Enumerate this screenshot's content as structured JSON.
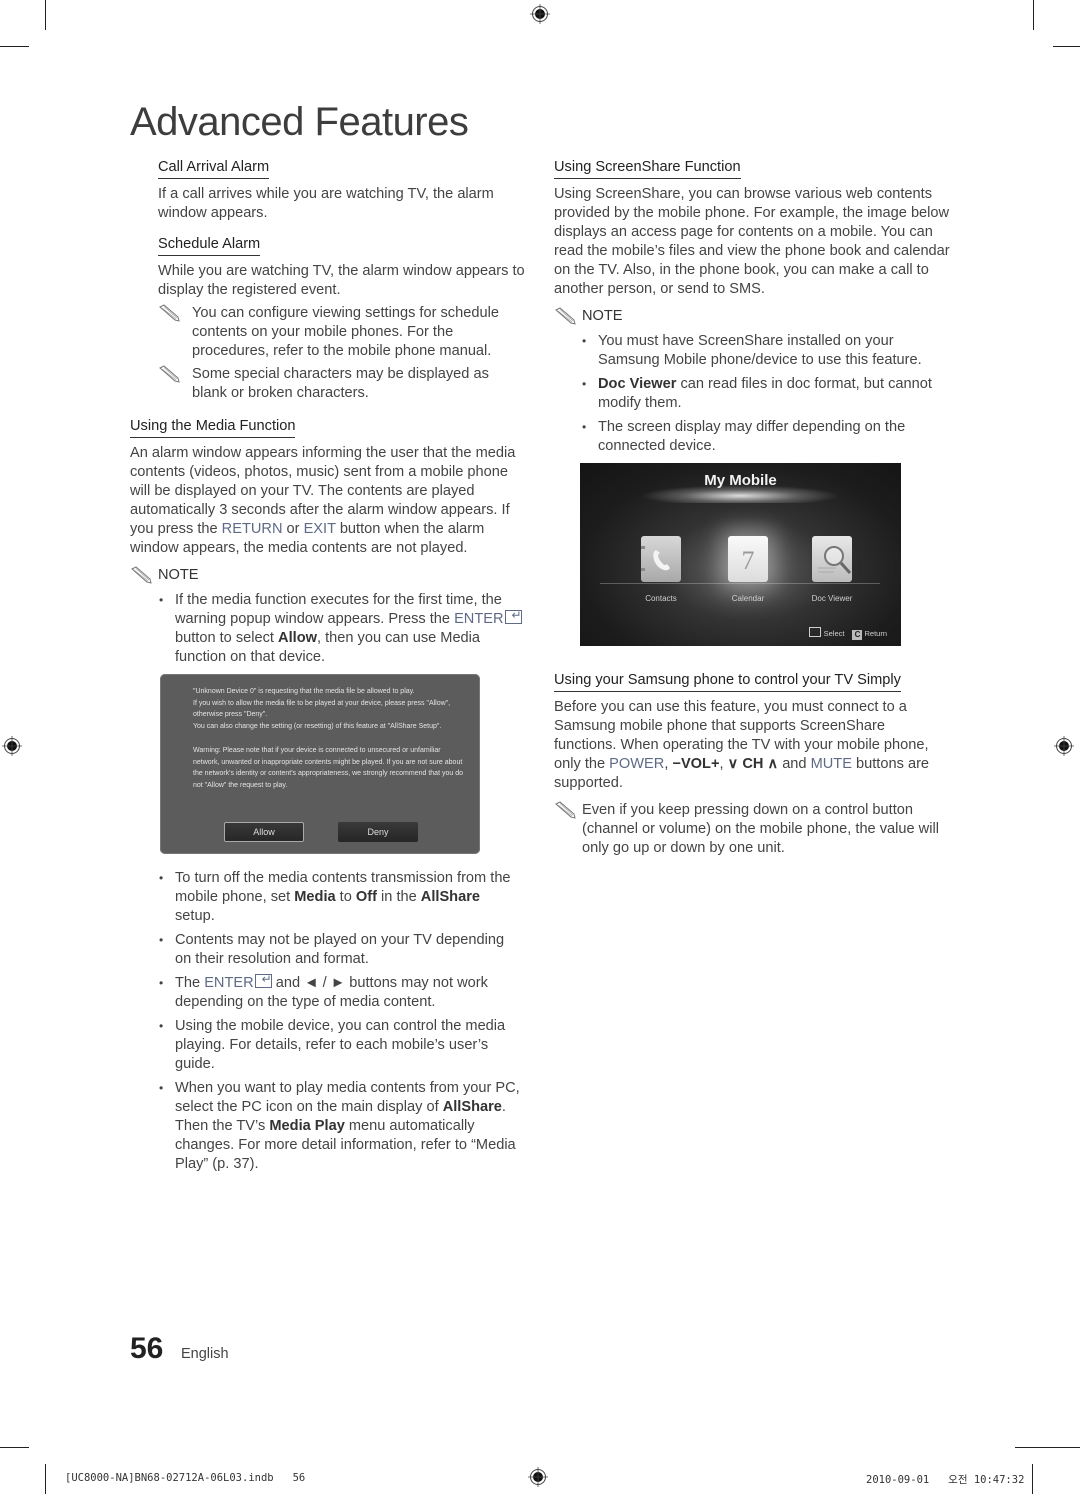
{
  "page": {
    "title": "Advanced Features",
    "page_number": "56",
    "language": "English"
  },
  "left_column": {
    "call_arrival": {
      "heading": "Call Arrival Alarm",
      "body": "If a call arrives while you are watching TV, the alarm window appears."
    },
    "schedule_alarm": {
      "heading": "Schedule Alarm",
      "body": "While you are watching TV, the alarm window appears to display the registered event.",
      "notes": [
        "You can configure viewing settings for schedule contents on your mobile phones. For the procedures, refer to the mobile phone manual.",
        "Some special characters may be displayed as blank or broken characters."
      ]
    },
    "media_function": {
      "heading": "Using the Media Function",
      "body_1": "An alarm window appears informing the user that the media contents (videos, photos, music) sent from a mobile phone will be displayed on your TV. The contents are played automatically 3 seconds after the alarm window appears. If you press the ",
      "return_label": "RETURN",
      "or_text": " or ",
      "exit_label": "EXIT",
      "body_2": " button when the alarm window appears, the media contents are not played.",
      "note_label": "NOTE",
      "note_1": {
        "pre": "If the media function executes for the first time, the warning popup window appears. Press the ",
        "enter": "ENTER",
        "mid": " button to select ",
        "allow": "Allow",
        "post": ", then you can use Media function on that device."
      },
      "bullets_after_popup": {
        "b1": {
          "pre": "To turn off the media contents transmission from the mobile phone, set ",
          "media": "Media",
          "to": " to ",
          "off": "Off",
          "in_the": " in the ",
          "allshare": "AllShare",
          "post": " setup."
        },
        "b2": "Contents may not be played on your TV depending on their resolution and format.",
        "b3": {
          "pre": "The ",
          "enter": "ENTER",
          "post": " and ◄ / ► buttons may not work depending on the type of media content."
        },
        "b4": "Using the mobile device, you can control the media playing. For details, refer to each mobile’s user’s guide.",
        "b5": {
          "pre": "When you want to play media contents from your PC, select the PC icon on the main display of ",
          "allshare": "AllShare",
          "mid": ". Then the TV’s ",
          "media_play": "Media Play",
          "post": " menu automatically changes. For more detail information, refer to “Media Play” (p. 37)."
        }
      }
    },
    "popup": {
      "line1": "\"Unknown Device 0\" is requesting that the media file be allowed to play.",
      "line2": "If you wish to allow the media file to be played at your device, please press \"Allow\", otherwise press \"Deny\".",
      "line3": "You can also change the setting (or resetting) of this feature at \"AllShare Setup\".",
      "warning": "Warning: Please note that if your device is connected to unsecured or unfamiliar network, unwanted or inappropriate contents might be played. If you are not sure about the network's identity or content's appropriateness, we strongly recommend that you do not \"Allow\" the request to play.",
      "allow_button": "Allow",
      "deny_button": "Deny"
    }
  },
  "right_column": {
    "screenshare": {
      "heading": "Using ScreenShare Function",
      "body": "Using ScreenShare, you can browse various web contents provided by the mobile phone. For example, the image below displays an access page for contents on a mobile. You can read the mobile’s files and view the phone book and calendar on the TV. Also, in the phone book, you can make a call to another person, or send to SMS.",
      "note_label": "NOTE",
      "notes": {
        "n1": "You must have ScreenShare installed on your Samsung Mobile phone/device to use this feature.",
        "n2_bold": "Doc Viewer",
        "n2_rest": " can read files in doc format, but cannot modify them.",
        "n3": "The screen display may differ depending on the connected device."
      }
    },
    "my_mobile": {
      "title": "My Mobile",
      "items": [
        "Contacts",
        "Calendar",
        "Doc Viewer"
      ],
      "calendar_day": "7",
      "select_label": "Select",
      "return_key": "C",
      "return_label": "Return"
    },
    "control_tv": {
      "heading": "Using your Samsung phone to control your TV Simply",
      "body_pre": "Before you can use this feature, you must connect to a Samsung mobile phone that supports ScreenShare functions. When operating the TV with your mobile phone, only the ",
      "power": "POWER",
      "comma1": ", ",
      "vol": "−VOL+",
      "comma2": ", ",
      "ch": "∨ CH ∧",
      "and": " and ",
      "mute": "MUTE",
      "body_post": " buttons are supported.",
      "note": "Even if you keep pressing down on a control button (channel or volume) on the mobile phone, the value will only go up or down by one unit."
    }
  },
  "print_slug": {
    "file": "[UC8000-NA]BN68-02712A-06L03.indb   56",
    "timestamp": "2010-09-01   오전 10:47:32"
  },
  "colors": {
    "blue_keyword": "#5f6a86",
    "popup_bg": "#5c5c5c",
    "text": "#444444"
  }
}
